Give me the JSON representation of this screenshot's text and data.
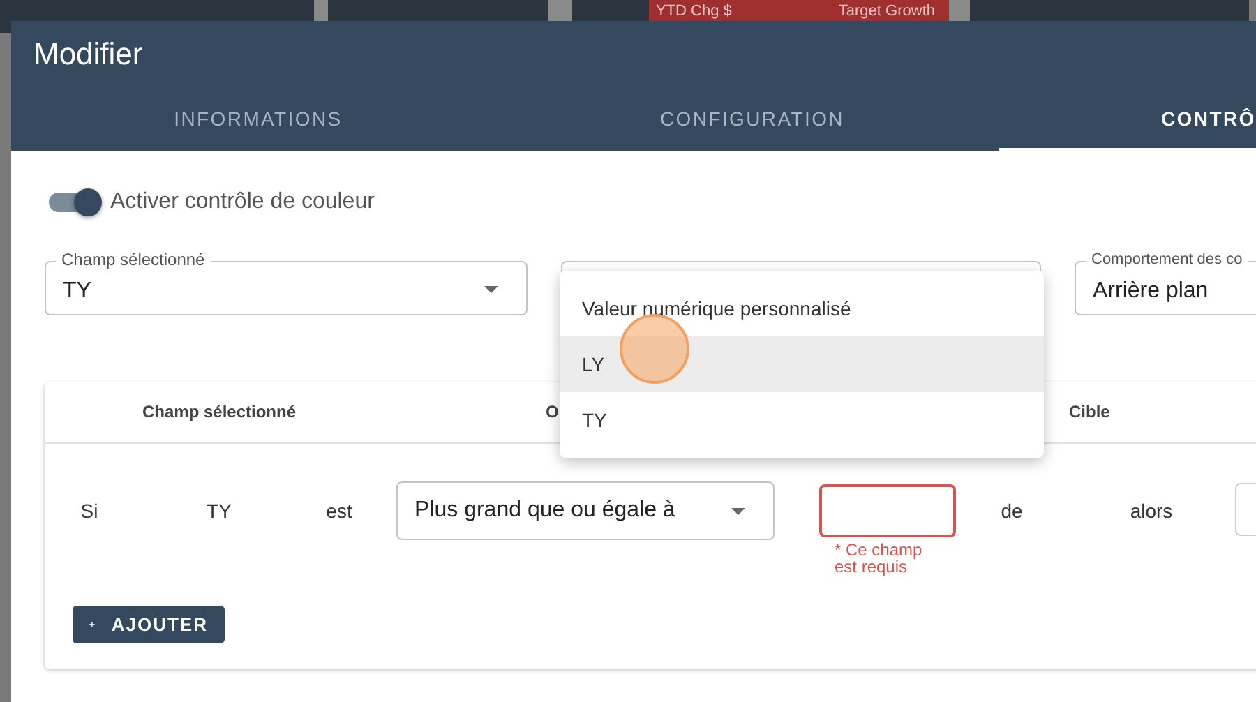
{
  "background": {
    "columns": [
      "YTD Chg $",
      "Target Growth"
    ]
  },
  "dialog": {
    "title": "Modifier",
    "tabs": [
      {
        "label": "INFORMATIONS",
        "selected": false
      },
      {
        "label": "CONFIGURATION",
        "selected": false
      },
      {
        "label": "CONTRÔ",
        "selected": true
      }
    ]
  },
  "color_control": {
    "label": "Activer contrôle de couleur",
    "on": true
  },
  "selects": [
    {
      "label": "Champ sélectionné",
      "value": "TY"
    },
    {
      "label": "Comportement des co",
      "value": "Arrière plan"
    }
  ],
  "menu": {
    "items": [
      {
        "label": "Valeur numérique personnalisé",
        "highlighted": false
      },
      {
        "label": "LY",
        "highlighted": true
      },
      {
        "label": "TY",
        "highlighted": false
      }
    ]
  },
  "rules_table": {
    "headers": [
      "Champ sélectionné",
      "O",
      "Cible"
    ],
    "rows": [
      {
        "if": "Si",
        "field": "TY",
        "is": "est",
        "operator": "Plus grand que ou égale à",
        "error": "* Ce champ est requis",
        "of": "de",
        "then": "alors"
      }
    ]
  },
  "add_button": {
    "label": "AJOUTER"
  }
}
